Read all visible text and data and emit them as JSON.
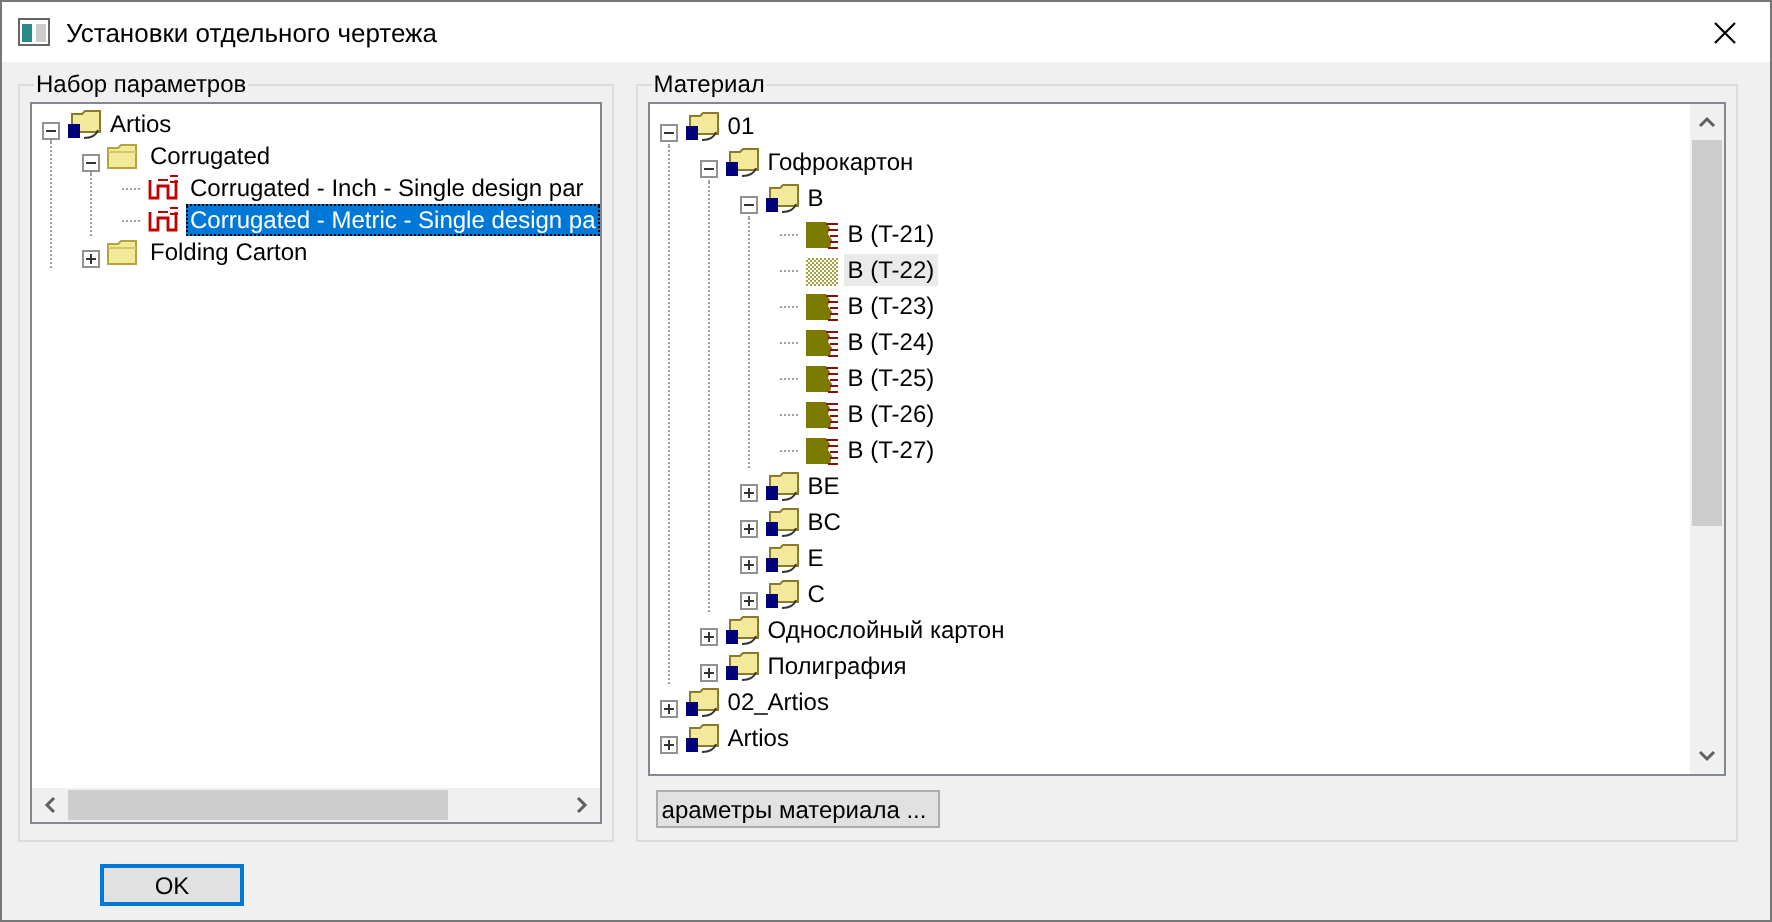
{
  "window": {
    "title": "Установки отдельного чертежа"
  },
  "parameter_set": {
    "label": "Набор параметров",
    "focused": true,
    "items": [
      {
        "kind": "library",
        "label": "Artios",
        "expanded": true,
        "selected": false,
        "children": [
          {
            "kind": "folder",
            "label": "Corrugated",
            "expanded": true,
            "selected": false,
            "children": [
              {
                "kind": "design",
                "label": "Corrugated - Inch - Single design par",
                "selected": false
              },
              {
                "kind": "design",
                "label": "Corrugated - Metric - Single design pa",
                "selected": true
              }
            ]
          },
          {
            "kind": "folder",
            "label": "Folding Carton",
            "expanded": false,
            "selected": false
          }
        ]
      }
    ]
  },
  "material": {
    "label": "Материал",
    "focused": false,
    "items": [
      {
        "kind": "library",
        "label": "01",
        "expanded": true,
        "selected": false,
        "children": [
          {
            "kind": "library",
            "label": "Гофрокартон",
            "expanded": true,
            "selected": false,
            "children": [
              {
                "kind": "library",
                "label": "B",
                "expanded": true,
                "selected": false,
                "children": [
                  {
                    "kind": "material",
                    "label": "B (T-21)",
                    "selected": false
                  },
                  {
                    "kind": "pattern",
                    "label": "B (T-22)",
                    "selected": true
                  },
                  {
                    "kind": "material",
                    "label": "B (T-23)",
                    "selected": false
                  },
                  {
                    "kind": "material",
                    "label": "B (T-24)",
                    "selected": false
                  },
                  {
                    "kind": "material",
                    "label": "B (T-25)",
                    "selected": false
                  },
                  {
                    "kind": "material",
                    "label": "B (T-26)",
                    "selected": false
                  },
                  {
                    "kind": "material",
                    "label": "B (T-27)",
                    "selected": false
                  }
                ]
              },
              {
                "kind": "library",
                "label": "BE",
                "expanded": false,
                "selected": false
              },
              {
                "kind": "library",
                "label": "BC",
                "expanded": false,
                "selected": false
              },
              {
                "kind": "library",
                "label": "E",
                "expanded": false,
                "selected": false
              },
              {
                "kind": "library",
                "label": "C",
                "expanded": false,
                "selected": false
              }
            ]
          },
          {
            "kind": "library",
            "label": "Однослойный картон",
            "expanded": false,
            "selected": false
          },
          {
            "kind": "library",
            "label": "Полиграфия",
            "expanded": false,
            "selected": false
          }
        ]
      },
      {
        "kind": "library",
        "label": "02_Artios",
        "expanded": false,
        "selected": false
      },
      {
        "kind": "library",
        "label": "Artios",
        "expanded": false,
        "selected": false
      }
    ],
    "button": "араметры материала ..."
  },
  "buttons": [
    {
      "label": "OK",
      "default": true
    }
  ]
}
